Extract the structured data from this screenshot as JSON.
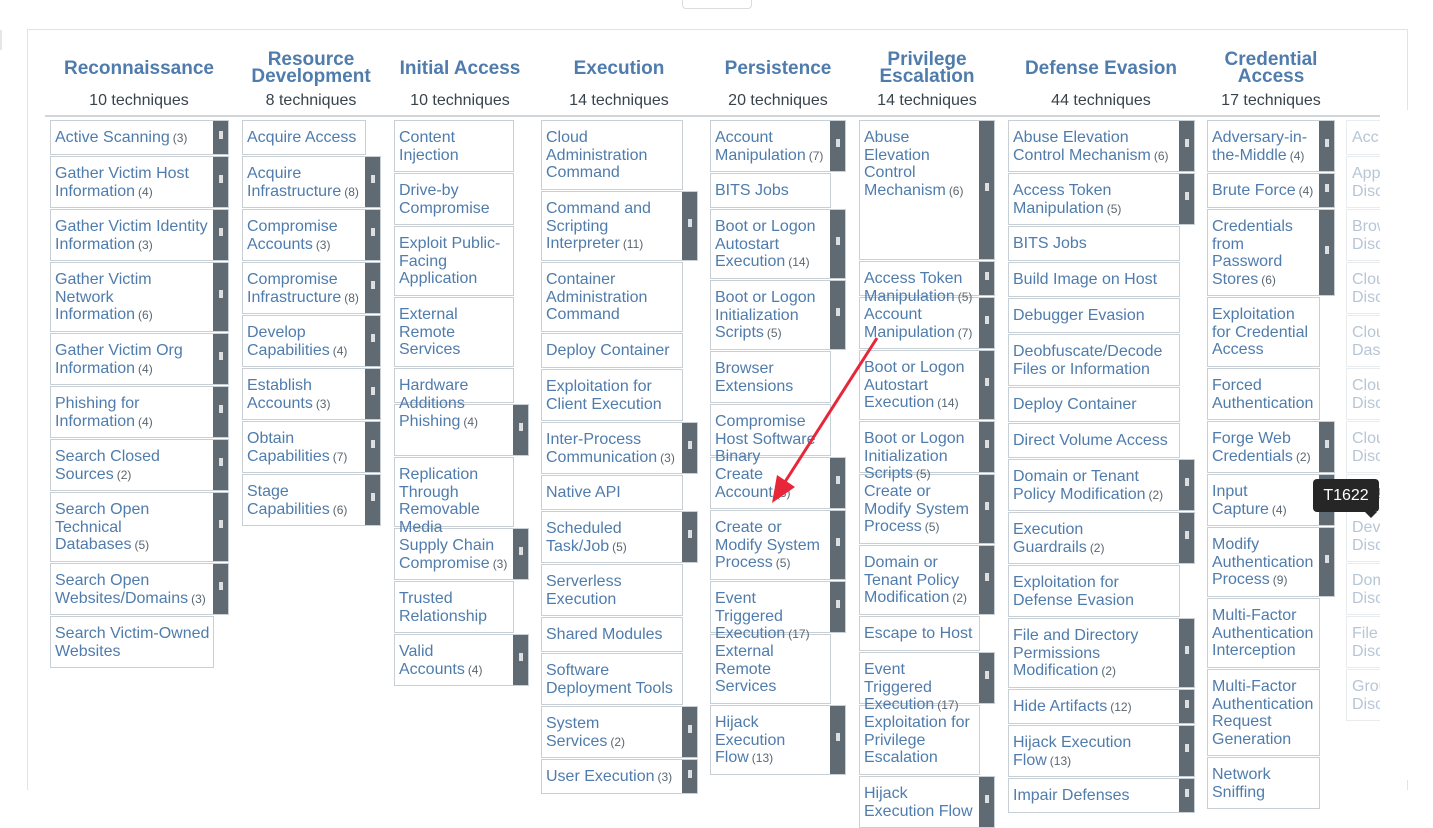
{
  "tactics": [
    {
      "name": "Reconnaissance",
      "count": "10 techniques",
      "techniques": [
        {
          "name": "Active Scanning",
          "count": "(3)",
          "sub": true
        },
        {
          "name": "Gather Victim Host Information",
          "count": "(4)",
          "sub": true
        },
        {
          "name": "Gather Victim Identity Information",
          "count": "(3)",
          "sub": true
        },
        {
          "name": "Gather Victim Network Information",
          "count": "(6)",
          "sub": true
        },
        {
          "name": "Gather Victim Org Information",
          "count": "(4)",
          "sub": true
        },
        {
          "name": "Phishing for Information",
          "count": "(4)",
          "sub": true
        },
        {
          "name": "Search Closed Sources",
          "count": "(2)",
          "sub": true
        },
        {
          "name": "Search Open Technical Databases",
          "count": "(5)",
          "sub": true
        },
        {
          "name": "Search Open Websites/Domains",
          "count": "(3)",
          "sub": true
        },
        {
          "name": "Search Victim-Owned Websites",
          "count": "",
          "sub": false
        }
      ]
    },
    {
      "name": "Resource Development",
      "count": "8 techniques",
      "techniques": [
        {
          "name": "Acquire Access",
          "count": "",
          "sub": false
        },
        {
          "name": "Acquire Infrastructure",
          "count": "(8)",
          "sub": true
        },
        {
          "name": "Compromise Accounts",
          "count": "(3)",
          "sub": true
        },
        {
          "name": "Compromise Infrastructure",
          "count": "(8)",
          "sub": true
        },
        {
          "name": "Develop Capabilities",
          "count": "(4)",
          "sub": true
        },
        {
          "name": "Establish Accounts",
          "count": "(3)",
          "sub": true
        },
        {
          "name": "Obtain Capabilities",
          "count": "(7)",
          "sub": true
        },
        {
          "name": "Stage Capabilities",
          "count": "(6)",
          "sub": true
        }
      ]
    },
    {
      "name": "Initial Access",
      "count": "10 techniques",
      "techniques": [
        {
          "name": "Content Injection",
          "count": "",
          "sub": false
        },
        {
          "name": "Drive-by Compromise",
          "count": "",
          "sub": false
        },
        {
          "name": "Exploit Public-Facing Application",
          "count": "",
          "sub": false
        },
        {
          "name": "External Remote Services",
          "count": "",
          "sub": false
        },
        {
          "name": "Hardware Additions",
          "count": "",
          "sub": false
        },
        {
          "name": "Phishing",
          "count": "(4)",
          "sub": true
        },
        {
          "name": "Replication Through Removable Media",
          "count": "",
          "sub": false
        },
        {
          "name": "Supply Chain Compromise",
          "count": "(3)",
          "sub": true
        },
        {
          "name": "Trusted Relationship",
          "count": "",
          "sub": false
        },
        {
          "name": "Valid Accounts",
          "count": "(4)",
          "sub": true
        }
      ]
    },
    {
      "name": "Execution",
      "count": "14 techniques",
      "techniques": [
        {
          "name": "Cloud Administration Command",
          "count": "",
          "sub": false
        },
        {
          "name": "Command and Scripting Interpreter",
          "count": "(11)",
          "sub": true
        },
        {
          "name": "Container Administration Command",
          "count": "",
          "sub": false
        },
        {
          "name": "Deploy Container",
          "count": "",
          "sub": false
        },
        {
          "name": "Exploitation for Client Execution",
          "count": "",
          "sub": false
        },
        {
          "name": "Inter-Process Communication",
          "count": "(3)",
          "sub": true
        },
        {
          "name": "Native API",
          "count": "",
          "sub": false
        },
        {
          "name": "Scheduled Task/Job",
          "count": "(5)",
          "sub": true
        },
        {
          "name": "Serverless Execution",
          "count": "",
          "sub": false
        },
        {
          "name": "Shared Modules",
          "count": "",
          "sub": false
        },
        {
          "name": "Software Deployment Tools",
          "count": "",
          "sub": false
        },
        {
          "name": "System Services",
          "count": "(2)",
          "sub": true
        },
        {
          "name": "User Execution",
          "count": "(3)",
          "sub": true
        }
      ]
    },
    {
      "name": "Persistence",
      "count": "20 techniques",
      "techniques": [
        {
          "name": "Account Manipulation",
          "count": "(7)",
          "sub": true
        },
        {
          "name": "BITS Jobs",
          "count": "",
          "sub": false
        },
        {
          "name": "Boot or Logon Autostart Execution",
          "count": "(14)",
          "sub": true
        },
        {
          "name": "Boot or Logon Initialization Scripts",
          "count": "(5)",
          "sub": true
        },
        {
          "name": "Browser Extensions",
          "count": "",
          "sub": false
        },
        {
          "name": "Compromise Host Software Binary",
          "count": "",
          "sub": false
        },
        {
          "name": "Create Account",
          "count": "(3)",
          "sub": true
        },
        {
          "name": "Create or Modify System Process",
          "count": "(5)",
          "sub": true
        },
        {
          "name": "Event Triggered Execution",
          "count": "(17)",
          "sub": true
        },
        {
          "name": "External Remote Services",
          "count": "",
          "sub": false
        },
        {
          "name": "Hijack Execution Flow",
          "count": "(13)",
          "sub": true
        }
      ]
    },
    {
      "name": "Privilege Escalation",
      "count": "14 techniques",
      "techniques": [
        {
          "name": "Abuse Elevation Control Mechanism",
          "count": "(6)",
          "sub": true
        },
        {
          "name": "Access Token Manipulation",
          "count": "(5)",
          "sub": true
        },
        {
          "name": "Account Manipulation",
          "count": "(7)",
          "sub": true
        },
        {
          "name": "Boot or Logon Autostart Execution",
          "count": "(14)",
          "sub": true
        },
        {
          "name": "Boot or Logon Initialization Scripts",
          "count": "(5)",
          "sub": true
        },
        {
          "name": "Create or Modify System Process",
          "count": "(5)",
          "sub": true
        },
        {
          "name": "Domain or Tenant Policy Modification",
          "count": "(2)",
          "sub": true
        },
        {
          "name": "Escape to Host",
          "count": "",
          "sub": false
        },
        {
          "name": "Event Triggered Execution",
          "count": "(17)",
          "sub": true
        },
        {
          "name": "Exploitation for Privilege Escalation",
          "count": "",
          "sub": false
        },
        {
          "name": "Hijack Execution Flow",
          "count": "",
          "sub": true
        }
      ]
    },
    {
      "name": "Defense Evasion",
      "count": "44 techniques",
      "techniques": [
        {
          "name": "Abuse Elevation Control Mechanism",
          "count": "(6)",
          "sub": true
        },
        {
          "name": "Access Token Manipulation",
          "count": "(5)",
          "sub": true
        },
        {
          "name": "BITS Jobs",
          "count": "",
          "sub": false
        },
        {
          "name": "Build Image on Host",
          "count": "",
          "sub": false
        },
        {
          "name": "Debugger Evasion",
          "count": "",
          "sub": false
        },
        {
          "name": "Deobfuscate/Decode Files or Information",
          "count": "",
          "sub": false
        },
        {
          "name": "Deploy Container",
          "count": "",
          "sub": false
        },
        {
          "name": "Direct Volume Access",
          "count": "",
          "sub": false
        },
        {
          "name": "Domain or Tenant Policy Modification",
          "count": "(2)",
          "sub": true
        },
        {
          "name": "Execution Guardrails",
          "count": "(2)",
          "sub": true
        },
        {
          "name": "Exploitation for Defense Evasion",
          "count": "",
          "sub": false
        },
        {
          "name": "File and Directory Permissions Modification",
          "count": "(2)",
          "sub": true
        },
        {
          "name": "Hide Artifacts",
          "count": "(12)",
          "sub": true
        },
        {
          "name": "Hijack Execution Flow",
          "count": "(13)",
          "sub": true
        },
        {
          "name": "Impair Defenses",
          "count": "",
          "sub": true
        }
      ]
    },
    {
      "name": "Credential Access",
      "count": "17 techniques",
      "techniques": [
        {
          "name": "Adversary-in-the-Middle",
          "count": "(4)",
          "sub": true
        },
        {
          "name": "Brute Force",
          "count": "(4)",
          "sub": true
        },
        {
          "name": "Credentials from Password Stores",
          "count": "(6)",
          "sub": true
        },
        {
          "name": "Exploitation for Credential Access",
          "count": "",
          "sub": false
        },
        {
          "name": "Forced Authentication",
          "count": "",
          "sub": false
        },
        {
          "name": "Forge Web Credentials",
          "count": "(2)",
          "sub": true
        },
        {
          "name": "Input Capture",
          "count": "(4)",
          "sub": true
        },
        {
          "name": "Modify Authentication Process",
          "count": "(9)",
          "sub": true
        },
        {
          "name": "Multi-Factor Authentication Interception",
          "count": "",
          "sub": false
        },
        {
          "name": "Multi-Factor Authentication Request Generation",
          "count": "",
          "sub": false
        },
        {
          "name": "Network Sniffing",
          "count": "",
          "sub": false
        }
      ]
    }
  ],
  "discovery_partial": [
    "Acc",
    "App Disc",
    "Brow Disc",
    "Clou Disc",
    "Clou Dash",
    "Clou Disc",
    "Clou Disc",
    "Debu",
    "Devi Disc",
    "Dom Disc",
    "File Disc",
    "Grou Disc"
  ],
  "tooltip": "T1622",
  "colors": {
    "accent": "#4f7cac",
    "handle": "#5f6a73",
    "arrow": "#e8263a"
  }
}
